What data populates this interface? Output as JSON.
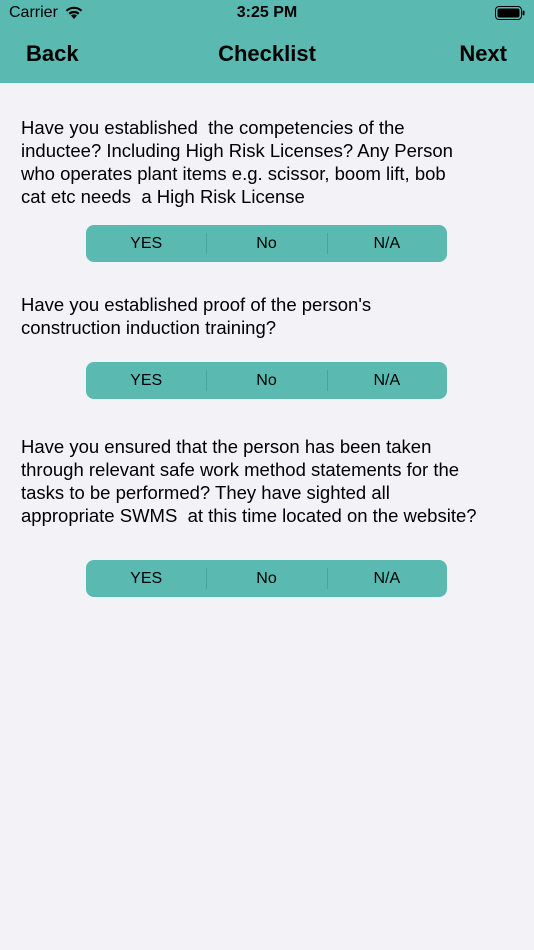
{
  "status_bar": {
    "carrier": "Carrier",
    "time": "3:25 PM",
    "wifi_icon": "wifi-icon",
    "battery_icon": "battery-icon"
  },
  "nav": {
    "back_label": "Back",
    "title": "Checklist",
    "next_label": "Next"
  },
  "questions": [
    {
      "text": "Have you established  the competencies of the\ninductee? Including High Risk Licenses? Any Person\nwho operates plant items e.g. scissor, boom lift, bob\ncat etc needs  a High Risk License",
      "options": [
        "YES",
        "No",
        "N/A"
      ]
    },
    {
      "text": "Have you established proof of the person's\nconstruction induction training?",
      "options": [
        "YES",
        "No",
        "N/A"
      ]
    },
    {
      "text": "Have you ensured that the person has been taken\nthrough relevant safe work method statements for the\ntasks to be performed? They have sighted all\nappropriate SWMS  at this time located on the website?",
      "options": [
        "YES",
        "No",
        "N/A"
      ]
    }
  ],
  "colors": {
    "accent": "#5ab9b0",
    "background": "#f2f2f7"
  }
}
